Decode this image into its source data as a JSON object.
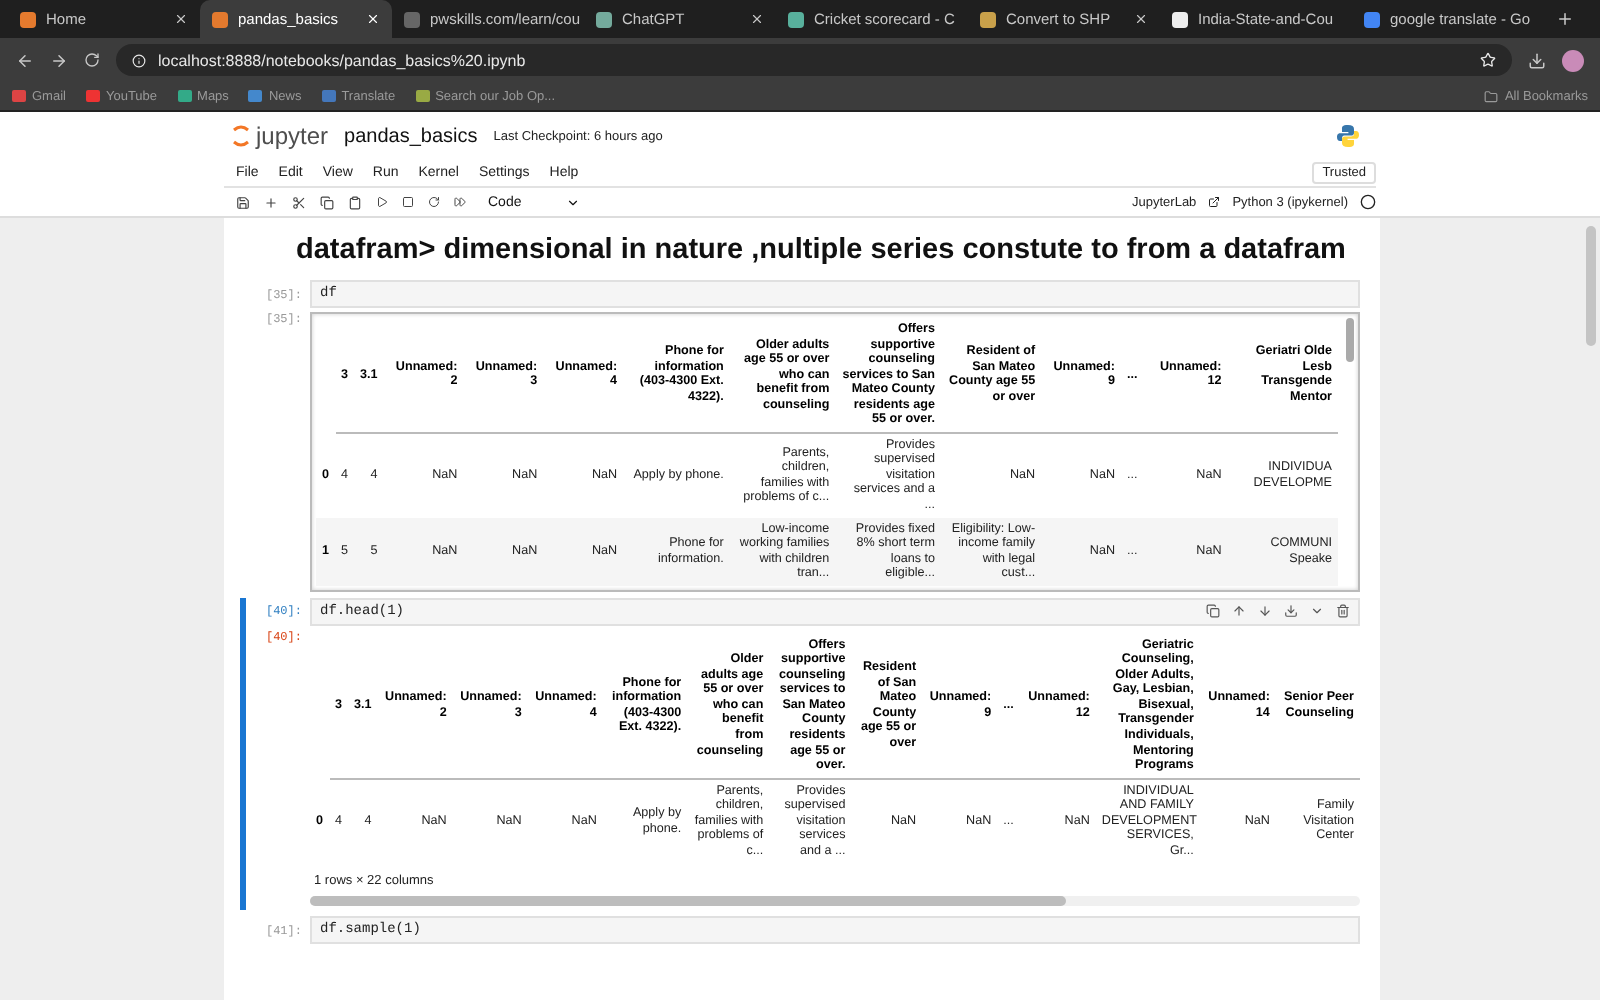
{
  "browser": {
    "tabs": [
      {
        "label": "Home",
        "selected": false
      },
      {
        "label": "pandas_basics",
        "selected": true
      },
      {
        "label": "pwskills.com/learn/cou",
        "selected": false
      },
      {
        "label": "ChatGPT",
        "selected": false
      },
      {
        "label": "Cricket scorecard - C",
        "selected": false
      },
      {
        "label": "Convert to SHP",
        "selected": false
      },
      {
        "label": "India-State-and-Cou",
        "selected": false
      },
      {
        "label": "google translate - Go",
        "selected": false
      }
    ],
    "address": "localhost:8888/notebooks/pandas_basics%20.ipynb",
    "bookmarks": [
      "Gmail",
      "YouTube",
      "Maps",
      "News",
      "Translate",
      "Search our Job Op..."
    ],
    "all_bookmarks": "All Bookmarks"
  },
  "jupyter": {
    "logo": "jupyter",
    "notebook": "pandas_basics",
    "checkpoint": "Last Checkpoint: 6 hours ago",
    "menu": [
      "File",
      "Edit",
      "View",
      "Run",
      "Kernel",
      "Settings",
      "Help"
    ],
    "trusted": "Trusted",
    "cell_type": "Code",
    "lab_link": "JupyterLab",
    "kernel": "Python 3 (ipykernel)"
  },
  "cells": [
    {
      "kind": "markdown",
      "text": "datafram> dimensional in nature ,nultiple series constute to from a datafram"
    },
    {
      "kind": "code",
      "prompt": "[35]:",
      "source": "df",
      "selected": false,
      "output": {
        "prompt": "[35]:",
        "scrolled": true,
        "columns": [
          "3",
          "3.1",
          "Unnamed: 2",
          "Unnamed: 3",
          "Unnamed: 4",
          "Phone for information (403-4300 Ext. 4322).",
          "Older adults age 55 or over who can benefit from counseling",
          "Offers supportive counseling services to San Mateo County residents age 55 or over.",
          "Resident of San Mateo County age 55 or over",
          "Unnamed: 9",
          "...",
          "Unnamed: 12",
          "Geriatri Olde Lesb Transgende Mentor"
        ],
        "rows": [
          {
            "index": "0",
            "cells": [
              "4",
              "4",
              "NaN",
              "NaN",
              "NaN",
              "Apply by phone.",
              "Parents, children, families with problems of c...",
              "Provides supervised visitation services and a ...",
              "NaN",
              "NaN",
              "...",
              "NaN",
              "INDIVIDUA DEVELOPME"
            ]
          },
          {
            "index": "1",
            "cells": [
              "5",
              "5",
              "NaN",
              "NaN",
              "NaN",
              "Phone for information.",
              "Low-income working families with children tran...",
              "Provides fixed 8% short term loans to eligible...",
              "Eligibility: Low-income family with legal cust...",
              "NaN",
              "...",
              "NaN",
              "COMMUNI Speake"
            ]
          }
        ]
      }
    },
    {
      "kind": "code",
      "prompt": "[40]:",
      "source": "df.head(1)",
      "selected": true,
      "output": {
        "prompt": "[40]:",
        "scrolled": false,
        "columns": [
          "3",
          "3.1",
          "Unnamed: 2",
          "Unnamed: 3",
          "Unnamed: 4",
          "Phone for information (403-4300 Ext. 4322).",
          "Older adults age 55 or over who can benefit from counseling",
          "Offers supportive counseling services to San Mateo County residents age 55 or over.",
          "Resident of San Mateo County age 55 or over",
          "Unnamed: 9",
          "...",
          "Unnamed: 12",
          "Geriatric Counseling, Older Adults, Gay, Lesbian, Bisexual, Transgender Individuals, Mentoring Programs",
          "Unnamed: 14",
          "Senior Peer Counseling"
        ],
        "rows": [
          {
            "index": "0",
            "cells": [
              "4",
              "4",
              "NaN",
              "NaN",
              "NaN",
              "Apply by phone.",
              "Parents, children, families with problems of c...",
              "Provides supervised visitation services and a ...",
              "NaN",
              "NaN",
              "...",
              "NaN",
              "INDIVIDUAL AND FAMILY DEVELOPMENT SERVICES, Gr...",
              "NaN",
              "Family Visitation Center"
            ]
          }
        ],
        "footer": "1 rows × 22 columns"
      }
    },
    {
      "kind": "code",
      "prompt": "[41]:",
      "source": "df.sample(1)",
      "selected": false
    }
  ]
}
